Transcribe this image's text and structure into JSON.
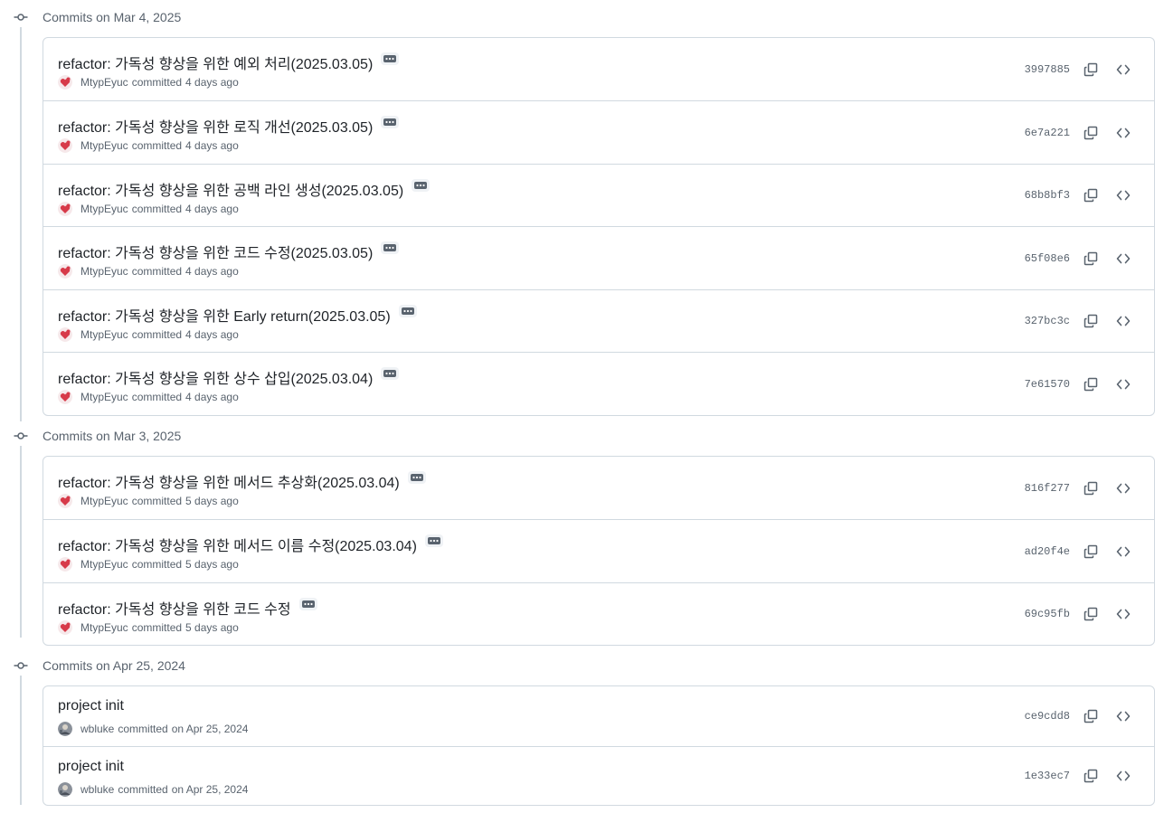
{
  "groups": [
    {
      "title": "Commits on Mar 4, 2025",
      "commits": [
        {
          "message": "refactor: 가독성 향상을 위한 예외 처리(2025.03.05)",
          "author": "MtypEyuc",
          "action": "committed",
          "time": "4 days ago",
          "sha": "3997885",
          "avatar": "heart"
        },
        {
          "message": "refactor: 가독성 향상을 위한 로직 개선(2025.03.05)",
          "author": "MtypEyuc",
          "action": "committed",
          "time": "4 days ago",
          "sha": "6e7a221",
          "avatar": "heart"
        },
        {
          "message": "refactor: 가독성 향상을 위한 공백 라인 생성(2025.03.05)",
          "author": "MtypEyuc",
          "action": "committed",
          "time": "4 days ago",
          "sha": "68b8bf3",
          "avatar": "heart"
        },
        {
          "message": "refactor: 가독성 향상을 위한 코드 수정(2025.03.05)",
          "author": "MtypEyuc",
          "action": "committed",
          "time": "4 days ago",
          "sha": "65f08e6",
          "avatar": "heart"
        },
        {
          "message": "refactor: 가독성 향상을 위한 Early return(2025.03.05)",
          "author": "MtypEyuc",
          "action": "committed",
          "time": "4 days ago",
          "sha": "327bc3c",
          "avatar": "heart"
        },
        {
          "message": "refactor: 가독성 향상을 위한 상수 삽입(2025.03.04)",
          "author": "MtypEyuc",
          "action": "committed",
          "time": "4 days ago",
          "sha": "7e61570",
          "avatar": "heart"
        }
      ]
    },
    {
      "title": "Commits on Mar 3, 2025",
      "commits": [
        {
          "message": "refactor: 가독성 향상을 위한 메서드 추상화(2025.03.04)",
          "author": "MtypEyuc",
          "action": "committed",
          "time": "5 days ago",
          "sha": "816f277",
          "avatar": "heart"
        },
        {
          "message": "refactor: 가독성 향상을 위한 메서드 이름 수정(2025.03.04)",
          "author": "MtypEyuc",
          "action": "committed",
          "time": "5 days ago",
          "sha": "ad20f4e",
          "avatar": "heart"
        },
        {
          "message": "refactor: 가독성 향상을 위한 코드 수정",
          "author": "MtypEyuc",
          "action": "committed",
          "time": "5 days ago",
          "sha": "69c95fb",
          "avatar": "heart"
        }
      ]
    },
    {
      "title": "Commits on Apr 25, 2024",
      "commits": [
        {
          "message": "project init",
          "author": "wbluke",
          "action": "committed",
          "time": "on Apr 25, 2024",
          "sha": "ce9cdd8",
          "avatar": "photo"
        },
        {
          "message": "project init",
          "author": "wbluke",
          "action": "committed",
          "time": "on Apr 25, 2024",
          "sha": "1e33ec7",
          "avatar": "photo"
        }
      ]
    }
  ],
  "icons": {
    "timeline": "git-commit-icon",
    "ellipsis": "ellipsis-icon",
    "copy": "copy-icon",
    "browse": "code-icon"
  },
  "colors": {
    "border": "#d1d9e0",
    "muted": "#59636e",
    "text": "#1f2328",
    "avatar_heart": "#d73a49"
  }
}
